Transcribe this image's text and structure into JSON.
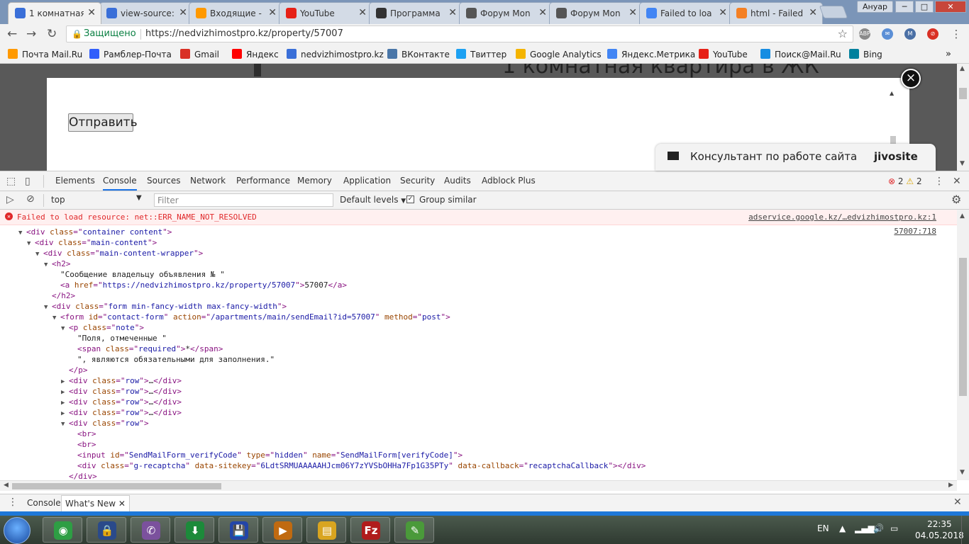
{
  "tabs": [
    {
      "title": "1 комнатная",
      "favicon": "house-icon",
      "color": "#3a6fd8",
      "active": true
    },
    {
      "title": "view-source:",
      "favicon": "house-icon",
      "color": "#3a6fd8"
    },
    {
      "title": "Входящие - ",
      "favicon": "mail-at-icon",
      "color": "#ff9900"
    },
    {
      "title": "YouTube",
      "favicon": "youtube-icon",
      "color": "#e62117"
    },
    {
      "title": "Программа",
      "favicon": "film-icon",
      "color": "#333333"
    },
    {
      "title": "Форум Mon",
      "favicon": "forum-m-icon",
      "color": "#555555"
    },
    {
      "title": "Форум Mon",
      "favicon": "forum-m-icon",
      "color": "#555555"
    },
    {
      "title": "Failed to loa",
      "favicon": "google-icon",
      "color": "#4285f4"
    },
    {
      "title": "html - Failed",
      "favicon": "stackoverflow-icon",
      "color": "#f48024"
    }
  ],
  "window": {
    "user": "Ануар",
    "minimize": "─",
    "maximize": "□",
    "close": "✕"
  },
  "omnibox": {
    "secure_label": "Защищено",
    "url": "https://nedvizhimostpro.kz/property/57007"
  },
  "bookmarks": [
    {
      "label": "Почта Mail.Ru",
      "icon": "mail-at-icon",
      "color": "#ff9900"
    },
    {
      "label": "Рамблер-Почта",
      "icon": "envelope-icon",
      "color": "#315efb"
    },
    {
      "label": "Gmail",
      "icon": "gmail-icon",
      "color": "#d93025"
    },
    {
      "label": "Яндекс",
      "icon": "yandex-icon",
      "color": "#ff0000"
    },
    {
      "label": "nedvizhimostpro.kz",
      "icon": "house-icon",
      "color": "#3a6fd8"
    },
    {
      "label": "ВКонтакте",
      "icon": "vk-icon",
      "color": "#4a76a8"
    },
    {
      "label": "Твиттер",
      "icon": "twitter-icon",
      "color": "#1da1f2"
    },
    {
      "label": "Google Analytics",
      "icon": "analytics-icon",
      "color": "#f4b400"
    },
    {
      "label": "Яндекс.Метрика",
      "icon": "metrika-icon",
      "color": "#4285f4"
    },
    {
      "label": "YouTube",
      "icon": "youtube-icon",
      "color": "#e62117"
    },
    {
      "label": "Поиск@Mail.Ru",
      "icon": "search-icon",
      "color": "#168de2"
    },
    {
      "label": "Bing",
      "icon": "bing-icon",
      "color": "#00809d"
    }
  ],
  "page": {
    "heading": "1 комнатная квартира в ЖК",
    "send_button": "Отправить",
    "close_symbol": "×",
    "jivo_label": "Консультант по работе сайта",
    "jivo_brand": "jivosite"
  },
  "devtools": {
    "tabs": [
      "Elements",
      "Console",
      "Sources",
      "Network",
      "Performance",
      "Memory",
      "Application",
      "Security",
      "Audits",
      "Adblock Plus"
    ],
    "selected_tab": "Console",
    "error_count": "2",
    "warning_count": "2",
    "context": "top",
    "filter_placeholder": "Filter",
    "levels": "Default levels",
    "group_similar": "Group similar",
    "error_message": "Failed to load resource: net::ERR_NAME_NOT_RESOLVED",
    "error_source": "adservice.google.kz/…edvizhimostpro.kz:1",
    "log_source": "57007:718",
    "drawer_tabs": [
      "Console",
      "What's New"
    ]
  },
  "dom_tree": [
    {
      "indent": 0,
      "tri": "▼",
      "parts": [
        [
          "tg",
          "<div "
        ],
        [
          "an",
          "class"
        ],
        [
          "tg",
          "=\""
        ],
        [
          "av",
          "container content"
        ],
        [
          "tg",
          "\">"
        ]
      ]
    },
    {
      "indent": 1,
      "tri": "▼",
      "parts": [
        [
          "tg",
          "<div "
        ],
        [
          "an",
          "class"
        ],
        [
          "tg",
          "=\""
        ],
        [
          "av",
          "main-content"
        ],
        [
          "tg",
          "\">"
        ]
      ]
    },
    {
      "indent": 2,
      "tri": "▼",
      "parts": [
        [
          "tg",
          "<div "
        ],
        [
          "an",
          "class"
        ],
        [
          "tg",
          "=\""
        ],
        [
          "av",
          "main-content-wrapper"
        ],
        [
          "tg",
          "\">"
        ]
      ]
    },
    {
      "indent": 3,
      "tri": "▼",
      "parts": [
        [
          "tg",
          "<h2>"
        ]
      ]
    },
    {
      "indent": 4,
      "tri": "",
      "parts": [
        [
          "tx",
          "\"Сообщение владельцу объявления № \""
        ]
      ]
    },
    {
      "indent": 4,
      "tri": "",
      "parts": [
        [
          "tg",
          "<a "
        ],
        [
          "an",
          "href"
        ],
        [
          "tg",
          "=\""
        ],
        [
          "av",
          "https://nedvizhimostpro.kz/property/57007"
        ],
        [
          "tg",
          "\">"
        ],
        [
          "tx",
          "57007"
        ],
        [
          "tg",
          "</a>"
        ]
      ]
    },
    {
      "indent": 3,
      "tri": "",
      "parts": [
        [
          "tg",
          "</h2>"
        ]
      ]
    },
    {
      "indent": 3,
      "tri": "▼",
      "parts": [
        [
          "tg",
          "<div "
        ],
        [
          "an",
          "class"
        ],
        [
          "tg",
          "=\""
        ],
        [
          "av",
          "form min-fancy-width max-fancy-width"
        ],
        [
          "tg",
          "\">"
        ]
      ]
    },
    {
      "indent": 4,
      "tri": "▼",
      "parts": [
        [
          "tg",
          "<form "
        ],
        [
          "an",
          "id"
        ],
        [
          "tg",
          "=\""
        ],
        [
          "av",
          "contact-form"
        ],
        [
          "tg",
          "\" "
        ],
        [
          "an",
          "action"
        ],
        [
          "tg",
          "=\""
        ],
        [
          "av",
          "/apartments/main/sendEmail?id=57007"
        ],
        [
          "tg",
          "\" "
        ],
        [
          "an",
          "method"
        ],
        [
          "tg",
          "=\""
        ],
        [
          "av",
          "post"
        ],
        [
          "tg",
          "\">"
        ]
      ]
    },
    {
      "indent": 5,
      "tri": "▼",
      "parts": [
        [
          "tg",
          "<p "
        ],
        [
          "an",
          "class"
        ],
        [
          "tg",
          "=\""
        ],
        [
          "av",
          "note"
        ],
        [
          "tg",
          "\">"
        ]
      ]
    },
    {
      "indent": 6,
      "tri": "",
      "parts": [
        [
          "tx",
          "\"Поля, отмеченные \""
        ]
      ]
    },
    {
      "indent": 6,
      "tri": "",
      "parts": [
        [
          "tg",
          "<span "
        ],
        [
          "an",
          "class"
        ],
        [
          "tg",
          "=\""
        ],
        [
          "av",
          "required"
        ],
        [
          "tg",
          "\">"
        ],
        [
          "tx",
          "*"
        ],
        [
          "tg",
          "</span>"
        ]
      ]
    },
    {
      "indent": 6,
      "tri": "",
      "parts": [
        [
          "tx",
          "\", являются обязательными для заполнения.\""
        ]
      ]
    },
    {
      "indent": 5,
      "tri": "",
      "parts": [
        [
          "tg",
          "</p>"
        ]
      ]
    },
    {
      "indent": 5,
      "tri": "▶",
      "parts": [
        [
          "tg",
          "<div "
        ],
        [
          "an",
          "class"
        ],
        [
          "tg",
          "=\""
        ],
        [
          "av",
          "row"
        ],
        [
          "tg",
          "\">"
        ],
        [
          "tx",
          "…"
        ],
        [
          "tg",
          "</div>"
        ]
      ]
    },
    {
      "indent": 5,
      "tri": "▶",
      "parts": [
        [
          "tg",
          "<div "
        ],
        [
          "an",
          "class"
        ],
        [
          "tg",
          "=\""
        ],
        [
          "av",
          "row"
        ],
        [
          "tg",
          "\">"
        ],
        [
          "tx",
          "…"
        ],
        [
          "tg",
          "</div>"
        ]
      ]
    },
    {
      "indent": 5,
      "tri": "▶",
      "parts": [
        [
          "tg",
          "<div "
        ],
        [
          "an",
          "class"
        ],
        [
          "tg",
          "=\""
        ],
        [
          "av",
          "row"
        ],
        [
          "tg",
          "\">"
        ],
        [
          "tx",
          "…"
        ],
        [
          "tg",
          "</div>"
        ]
      ]
    },
    {
      "indent": 5,
      "tri": "▶",
      "parts": [
        [
          "tg",
          "<div "
        ],
        [
          "an",
          "class"
        ],
        [
          "tg",
          "=\""
        ],
        [
          "av",
          "row"
        ],
        [
          "tg",
          "\">"
        ],
        [
          "tx",
          "…"
        ],
        [
          "tg",
          "</div>"
        ]
      ]
    },
    {
      "indent": 5,
      "tri": "▼",
      "parts": [
        [
          "tg",
          "<div "
        ],
        [
          "an",
          "class"
        ],
        [
          "tg",
          "=\""
        ],
        [
          "av",
          "row"
        ],
        [
          "tg",
          "\">"
        ]
      ]
    },
    {
      "indent": 6,
      "tri": "",
      "parts": [
        [
          "tg",
          "<br>"
        ]
      ]
    },
    {
      "indent": 6,
      "tri": "",
      "parts": [
        [
          "tg",
          "<br>"
        ]
      ]
    },
    {
      "indent": 6,
      "tri": "",
      "parts": [
        [
          "tg",
          "<input "
        ],
        [
          "an",
          "id"
        ],
        [
          "tg",
          "=\""
        ],
        [
          "av",
          "SendMailForm_verifyCode"
        ],
        [
          "tg",
          "\" "
        ],
        [
          "an",
          "type"
        ],
        [
          "tg",
          "=\""
        ],
        [
          "av",
          "hidden"
        ],
        [
          "tg",
          "\" "
        ],
        [
          "an",
          "name"
        ],
        [
          "tg",
          "=\""
        ],
        [
          "av",
          "SendMailForm[verifyCode]"
        ],
        [
          "tg",
          "\">"
        ]
      ]
    },
    {
      "indent": 6,
      "tri": "",
      "parts": [
        [
          "tg",
          "<div "
        ],
        [
          "an",
          "class"
        ],
        [
          "tg",
          "=\""
        ],
        [
          "av",
          "g-recaptcha"
        ],
        [
          "tg",
          "\" "
        ],
        [
          "an",
          "data-sitekey"
        ],
        [
          "tg",
          "=\""
        ],
        [
          "av",
          "6LdtSRMUAAAAAHJcm06Y7zYVSbOHHa7Fp1G35PTy"
        ],
        [
          "tg",
          "\" "
        ],
        [
          "an",
          "data-callback"
        ],
        [
          "tg",
          "=\""
        ],
        [
          "av",
          "recaptchaCallback"
        ],
        [
          "tg",
          "\">"
        ],
        [
          "tg",
          "</div>"
        ]
      ]
    },
    {
      "indent": 5,
      "tri": "",
      "parts": [
        [
          "tg",
          "</div>"
        ]
      ]
    }
  ],
  "taskbar": {
    "apps": [
      {
        "name": "chrome",
        "glyph": "◉",
        "color": "#2e9e44"
      },
      {
        "name": "lock-app",
        "glyph": "🔒",
        "color": "#2a4a8a"
      },
      {
        "name": "viber",
        "glyph": "✆",
        "color": "#7b519d"
      },
      {
        "name": "download-app",
        "glyph": "⬇",
        "color": "#1c8a3a"
      },
      {
        "name": "save-app",
        "glyph": "💾",
        "color": "#2345a8"
      },
      {
        "name": "media-player",
        "glyph": "▶",
        "color": "#c06a10"
      },
      {
        "name": "explorer",
        "glyph": "▤",
        "color": "#d9a520"
      },
      {
        "name": "filezilla",
        "glyph": "Fz",
        "color": "#b01c1c"
      },
      {
        "name": "notepad",
        "glyph": "✎",
        "color": "#4a9a3a"
      }
    ],
    "lang": "EN",
    "time": "22:35",
    "date": "04.05.2018"
  }
}
